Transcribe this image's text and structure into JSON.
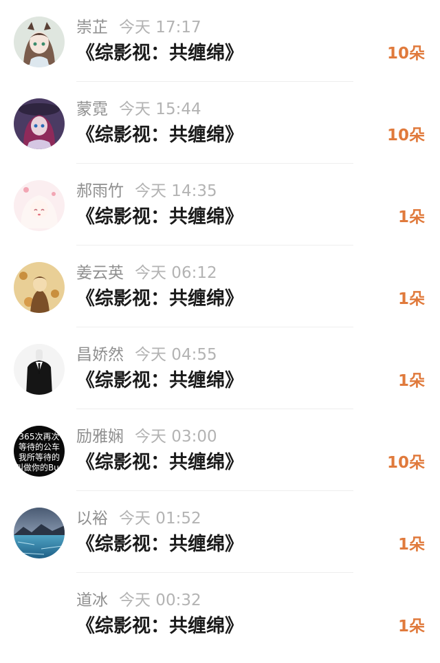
{
  "rows": [
    {
      "name": "崇芷",
      "time": "今天 17:17",
      "title": "《综影视：共缠绵》",
      "gift": "10朵",
      "avatar": "anime-girl-cat-ears"
    },
    {
      "name": "蒙霓",
      "time": "今天 15:44",
      "title": "《综影视：共缠绵》",
      "gift": "10朵",
      "avatar": "anime-girl-hat"
    },
    {
      "name": "郝雨竹",
      "time": "今天 14:35",
      "title": "《综影视：共缠绵》",
      "gift": "1朵",
      "avatar": "anime-girl-pink"
    },
    {
      "name": "姜云英",
      "time": "今天 06:12",
      "title": "《综影视：共缠绵》",
      "gift": "1朵",
      "avatar": "sepia-boy-flowers"
    },
    {
      "name": "昌娇然",
      "time": "今天 04:55",
      "title": "《综影视：共缠绵》",
      "gift": "1朵",
      "avatar": "man-in-suit"
    },
    {
      "name": "励雅娴",
      "time": "今天 03:00",
      "title": "《综影视：共缠绵》",
      "gift": "10朵",
      "avatar": "black-text-avatar",
      "avatar_text": [
        "365次再次",
        "等待的公车",
        "我所等待的",
        "叫做你的Bus"
      ]
    },
    {
      "name": "以裕",
      "time": "今天 01:52",
      "title": "《综影视：共缠绵》",
      "gift": "1朵",
      "avatar": "frozen-lake-landscape"
    },
    {
      "name": "道冰",
      "time": "今天 00:32",
      "title": "《综影视：共缠绵》",
      "gift": "1朵",
      "avatar": "none"
    }
  ],
  "colors": {
    "name": "#8f8f8f",
    "time": "#b3b3b3",
    "title": "#1a1a1a",
    "gift": "#e07a3c",
    "divider": "#eeeeee"
  }
}
